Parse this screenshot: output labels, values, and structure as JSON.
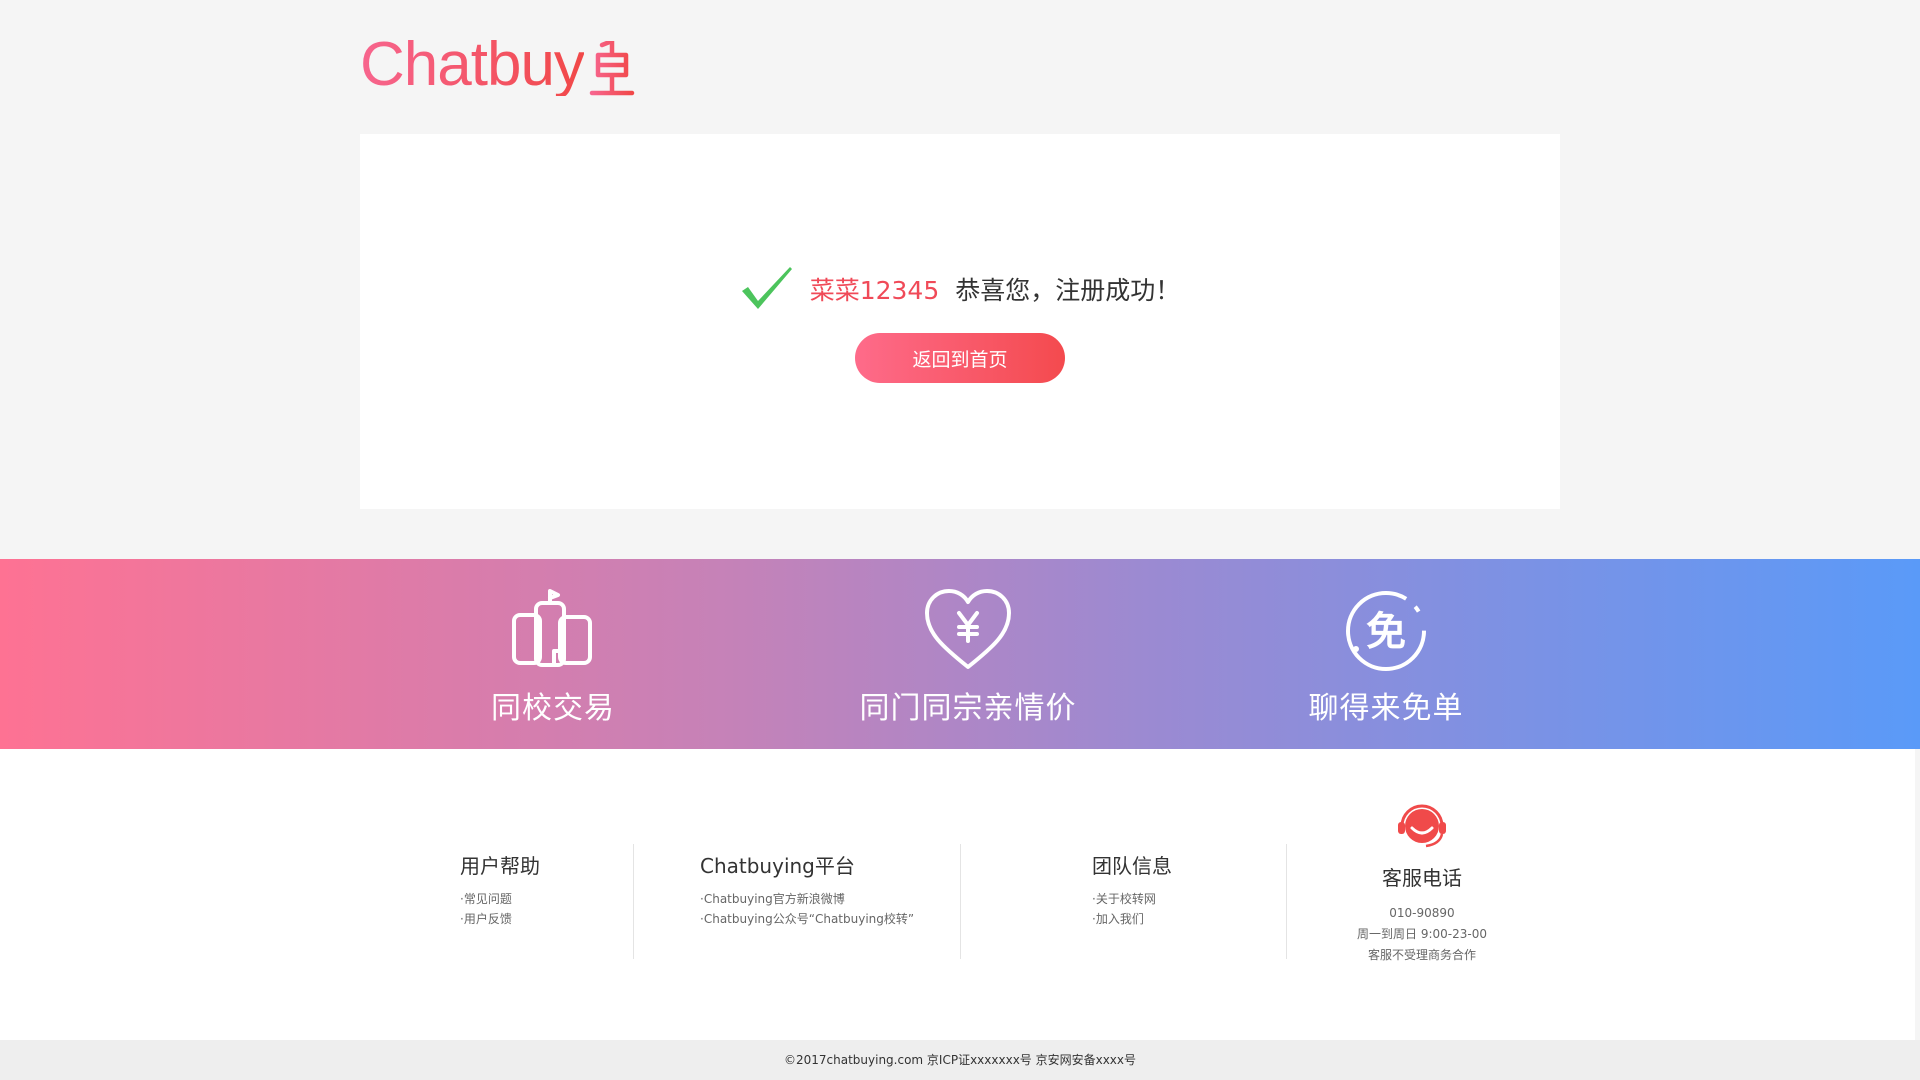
{
  "header": {
    "logo_text": "Chatbuy"
  },
  "success": {
    "username": "菜菜12345",
    "message": "恭喜您，注册成功！",
    "home_button": "返回到首页",
    "check_color": "#4cc45c"
  },
  "features": [
    {
      "icon": "trade-icon",
      "label": "同校交易"
    },
    {
      "icon": "heart-yen-icon",
      "label": "同门同宗亲情价"
    },
    {
      "icon": "free-badge-icon",
      "label": "聊得来免单",
      "icon_glyph": "免"
    }
  ],
  "footer": {
    "columns": [
      {
        "title": "用户帮助",
        "items": [
          "常见问题",
          "用户反馈"
        ]
      },
      {
        "title": "Chatbuying平台",
        "items": [
          "Chatbuying官方新浪微博",
          "Chatbuying公众号“Chatbuying校转”"
        ]
      },
      {
        "title": "团队信息",
        "items": [
          "关于校转网",
          "加入我们"
        ]
      }
    ],
    "service": {
      "icon": "customer-service-icon",
      "title": "客服电话",
      "phone": "010-90890",
      "hours": "周一到周日 9:00-23-00",
      "note": "客服不受理商务合作"
    }
  },
  "copyright": "©2017chatbuying.com 京ICP证xxxxxxx号 京安网安备xxxx号",
  "colors": {
    "brand_pink": "#f7658e",
    "brand_red": "#f14848",
    "banner_start": "#fe7293",
    "banner_end": "#5a9af8"
  }
}
